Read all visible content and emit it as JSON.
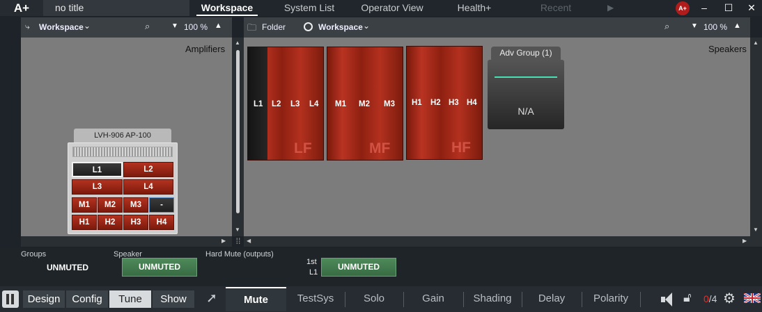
{
  "app": {
    "logo": "A+",
    "doc_title": "no title"
  },
  "nav": [
    {
      "label": "Workspace",
      "state": "active"
    },
    {
      "label": "System List",
      "state": "normal"
    },
    {
      "label": "Operator View",
      "state": "normal"
    },
    {
      "label": "Health+",
      "state": "normal"
    },
    {
      "label": "Recent",
      "state": "disabled"
    }
  ],
  "user_badge": "A+",
  "left_panel": {
    "workspace_label": "Workspace",
    "zoom": "100 %",
    "corner_label": "Amplifiers",
    "amplifier": {
      "title": "LVH-906 AP-100",
      "channels": [
        "L1",
        "L2",
        "L3",
        "L4",
        "M1",
        "M2",
        "M3",
        "-",
        "H1",
        "H2",
        "H3",
        "H4"
      ]
    }
  },
  "right_panel": {
    "folder_label": "Folder",
    "workspace_label": "Workspace",
    "zoom": "100 %",
    "corner_label": "Speakers",
    "speakers": [
      {
        "labels": [
          "L1",
          "L2",
          "L3",
          "L4"
        ],
        "big": "LF"
      },
      {
        "labels": [
          "M1",
          "M2",
          "M3"
        ],
        "big": "MF"
      },
      {
        "labels": [
          "H1",
          "H2",
          "H3",
          "H4"
        ],
        "big": "HF"
      }
    ],
    "adv_group": {
      "title": "Adv Group (1)",
      "value": "N/A"
    }
  },
  "status": {
    "groups_label": "Groups",
    "groups_value": "UNMUTED",
    "speaker_label": "Speaker",
    "speaker_value": "UNMUTED",
    "hardmute_label": "Hard Mute (outputs)",
    "output_line1": "1st",
    "output_line2": "L1",
    "output_value": "UNMUTED"
  },
  "modes": [
    "Design",
    "Config",
    "Tune",
    "Show"
  ],
  "active_mode": "Tune",
  "tabs": [
    "Mute",
    "TestSys",
    "Solo",
    "Gain",
    "Shading",
    "Delay",
    "Polarity"
  ],
  "active_tab": "Mute",
  "counter": {
    "current": "0",
    "total": "/4"
  },
  "colors": {
    "accent_green": "#49e0b4",
    "unmuted_green": "#4e8a5a",
    "speaker_red": "#b93322",
    "alert_red": "#e03030"
  }
}
